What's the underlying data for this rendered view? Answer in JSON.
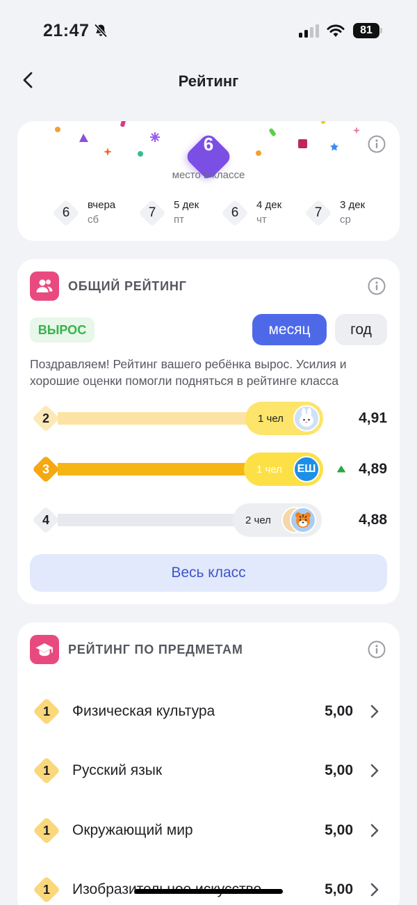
{
  "status_bar": {
    "time": "21:47",
    "battery": "81"
  },
  "header": {
    "title": "Рейтинг"
  },
  "place": {
    "number": "6",
    "caption": "место в классе",
    "history": [
      {
        "place": "6",
        "date": "вчера",
        "day": "сб"
      },
      {
        "place": "7",
        "date": "5 дек",
        "day": "пт"
      },
      {
        "place": "6",
        "date": "4 дек",
        "day": "чт"
      },
      {
        "place": "7",
        "date": "3 дек",
        "day": "ср"
      }
    ]
  },
  "general": {
    "title": "ОБЩИЙ РЕЙТИНГ",
    "badge": "ВЫРОС",
    "period_month": "месяц",
    "period_year": "год",
    "message": "Поздравляем! Рейтинг вашего ребёнка вырос. Усилия и хорошие оценки помогли подняться в рейтинге класса",
    "ranks": [
      {
        "place": "2",
        "people": "1 чел",
        "score": "4,91",
        "avatar": "bunny"
      },
      {
        "place": "3",
        "people": "1 чел",
        "score": "4,89",
        "avatar": "ЕШ",
        "current": true
      },
      {
        "place": "4",
        "people": "2 чел",
        "score": "4,88",
        "avatar": "tiger"
      }
    ],
    "whole_class_label": "Весь класс"
  },
  "subjects": {
    "title": "РЕЙТИНГ ПО ПРЕДМЕТАМ",
    "items": [
      {
        "rank": "1",
        "name": "Физическая культура",
        "score": "5,00"
      },
      {
        "rank": "1",
        "name": "Русский язык",
        "score": "5,00"
      },
      {
        "rank": "1",
        "name": "Окружающий мир",
        "score": "5,00"
      },
      {
        "rank": "1",
        "name": "Изобразительное искусство",
        "score": "5,00"
      }
    ]
  },
  "colors": {
    "accent": "#4e69e8",
    "place_badge": "#7b4fe4",
    "section_icon": "#e84a7f",
    "grew_green": "#37b34a",
    "rank_gold": "#f5b515",
    "rank_light_gold": "#fbd77c"
  }
}
